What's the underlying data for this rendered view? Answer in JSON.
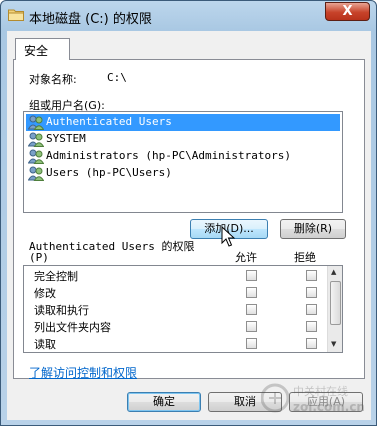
{
  "window": {
    "title": "本地磁盘 (C:) 的权限",
    "close_glyph": "X"
  },
  "tab": {
    "label": "安全"
  },
  "object": {
    "label": "对象名称:",
    "value": "C:\\"
  },
  "groups": {
    "label": "组或用户名(G):",
    "items": [
      {
        "name": "Authenticated Users",
        "selected": true
      },
      {
        "name": "SYSTEM",
        "selected": false
      },
      {
        "name": "Administrators (hp-PC\\Administrators)",
        "selected": false
      },
      {
        "name": "Users (hp-PC\\Users)",
        "selected": false
      }
    ]
  },
  "buttons": {
    "add": "添加(D)...",
    "remove": "删除(R)",
    "ok": "确定",
    "cancel": "取消",
    "apply": "应用(A)"
  },
  "permissions": {
    "title_line1": "Authenticated Users 的权限",
    "title_line2": "(P)",
    "col_allow": "允许",
    "col_deny": "拒绝",
    "rows": [
      {
        "name": "完全控制",
        "allow": false,
        "deny": false
      },
      {
        "name": "修改",
        "allow": false,
        "deny": false
      },
      {
        "name": "读取和执行",
        "allow": false,
        "deny": false
      },
      {
        "name": "列出文件夹内容",
        "allow": false,
        "deny": false
      },
      {
        "name": "读取",
        "allow": false,
        "deny": false
      }
    ]
  },
  "help_link": "了解访问控制和权限",
  "watermark": {
    "line1": "中关村在线",
    "line2": "zol.com.cn"
  }
}
